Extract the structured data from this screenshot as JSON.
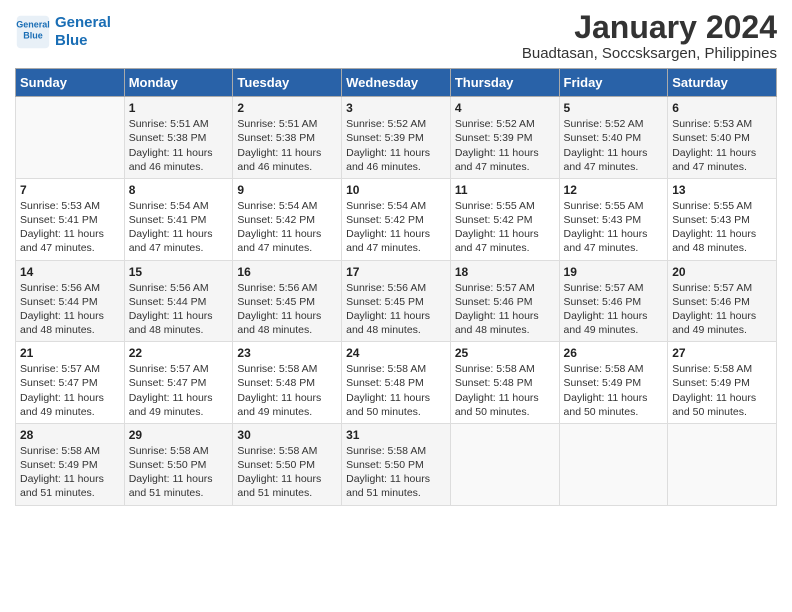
{
  "logo": {
    "line1": "General",
    "line2": "Blue"
  },
  "title": "January 2024",
  "subtitle": "Buadtasan, Soccsksargen, Philippines",
  "days_of_week": [
    "Sunday",
    "Monday",
    "Tuesday",
    "Wednesday",
    "Thursday",
    "Friday",
    "Saturday"
  ],
  "weeks": [
    [
      {
        "num": "",
        "info": ""
      },
      {
        "num": "1",
        "info": "Sunrise: 5:51 AM\nSunset: 5:38 PM\nDaylight: 11 hours\nand 46 minutes."
      },
      {
        "num": "2",
        "info": "Sunrise: 5:51 AM\nSunset: 5:38 PM\nDaylight: 11 hours\nand 46 minutes."
      },
      {
        "num": "3",
        "info": "Sunrise: 5:52 AM\nSunset: 5:39 PM\nDaylight: 11 hours\nand 46 minutes."
      },
      {
        "num": "4",
        "info": "Sunrise: 5:52 AM\nSunset: 5:39 PM\nDaylight: 11 hours\nand 47 minutes."
      },
      {
        "num": "5",
        "info": "Sunrise: 5:52 AM\nSunset: 5:40 PM\nDaylight: 11 hours\nand 47 minutes."
      },
      {
        "num": "6",
        "info": "Sunrise: 5:53 AM\nSunset: 5:40 PM\nDaylight: 11 hours\nand 47 minutes."
      }
    ],
    [
      {
        "num": "7",
        "info": "Sunrise: 5:53 AM\nSunset: 5:41 PM\nDaylight: 11 hours\nand 47 minutes."
      },
      {
        "num": "8",
        "info": "Sunrise: 5:54 AM\nSunset: 5:41 PM\nDaylight: 11 hours\nand 47 minutes."
      },
      {
        "num": "9",
        "info": "Sunrise: 5:54 AM\nSunset: 5:42 PM\nDaylight: 11 hours\nand 47 minutes."
      },
      {
        "num": "10",
        "info": "Sunrise: 5:54 AM\nSunset: 5:42 PM\nDaylight: 11 hours\nand 47 minutes."
      },
      {
        "num": "11",
        "info": "Sunrise: 5:55 AM\nSunset: 5:42 PM\nDaylight: 11 hours\nand 47 minutes."
      },
      {
        "num": "12",
        "info": "Sunrise: 5:55 AM\nSunset: 5:43 PM\nDaylight: 11 hours\nand 47 minutes."
      },
      {
        "num": "13",
        "info": "Sunrise: 5:55 AM\nSunset: 5:43 PM\nDaylight: 11 hours\nand 48 minutes."
      }
    ],
    [
      {
        "num": "14",
        "info": "Sunrise: 5:56 AM\nSunset: 5:44 PM\nDaylight: 11 hours\nand 48 minutes."
      },
      {
        "num": "15",
        "info": "Sunrise: 5:56 AM\nSunset: 5:44 PM\nDaylight: 11 hours\nand 48 minutes."
      },
      {
        "num": "16",
        "info": "Sunrise: 5:56 AM\nSunset: 5:45 PM\nDaylight: 11 hours\nand 48 minutes."
      },
      {
        "num": "17",
        "info": "Sunrise: 5:56 AM\nSunset: 5:45 PM\nDaylight: 11 hours\nand 48 minutes."
      },
      {
        "num": "18",
        "info": "Sunrise: 5:57 AM\nSunset: 5:46 PM\nDaylight: 11 hours\nand 48 minutes."
      },
      {
        "num": "19",
        "info": "Sunrise: 5:57 AM\nSunset: 5:46 PM\nDaylight: 11 hours\nand 49 minutes."
      },
      {
        "num": "20",
        "info": "Sunrise: 5:57 AM\nSunset: 5:46 PM\nDaylight: 11 hours\nand 49 minutes."
      }
    ],
    [
      {
        "num": "21",
        "info": "Sunrise: 5:57 AM\nSunset: 5:47 PM\nDaylight: 11 hours\nand 49 minutes."
      },
      {
        "num": "22",
        "info": "Sunrise: 5:57 AM\nSunset: 5:47 PM\nDaylight: 11 hours\nand 49 minutes."
      },
      {
        "num": "23",
        "info": "Sunrise: 5:58 AM\nSunset: 5:48 PM\nDaylight: 11 hours\nand 49 minutes."
      },
      {
        "num": "24",
        "info": "Sunrise: 5:58 AM\nSunset: 5:48 PM\nDaylight: 11 hours\nand 50 minutes."
      },
      {
        "num": "25",
        "info": "Sunrise: 5:58 AM\nSunset: 5:48 PM\nDaylight: 11 hours\nand 50 minutes."
      },
      {
        "num": "26",
        "info": "Sunrise: 5:58 AM\nSunset: 5:49 PM\nDaylight: 11 hours\nand 50 minutes."
      },
      {
        "num": "27",
        "info": "Sunrise: 5:58 AM\nSunset: 5:49 PM\nDaylight: 11 hours\nand 50 minutes."
      }
    ],
    [
      {
        "num": "28",
        "info": "Sunrise: 5:58 AM\nSunset: 5:49 PM\nDaylight: 11 hours\nand 51 minutes."
      },
      {
        "num": "29",
        "info": "Sunrise: 5:58 AM\nSunset: 5:50 PM\nDaylight: 11 hours\nand 51 minutes."
      },
      {
        "num": "30",
        "info": "Sunrise: 5:58 AM\nSunset: 5:50 PM\nDaylight: 11 hours\nand 51 minutes."
      },
      {
        "num": "31",
        "info": "Sunrise: 5:58 AM\nSunset: 5:50 PM\nDaylight: 11 hours\nand 51 minutes."
      },
      {
        "num": "",
        "info": ""
      },
      {
        "num": "",
        "info": ""
      },
      {
        "num": "",
        "info": ""
      }
    ]
  ]
}
